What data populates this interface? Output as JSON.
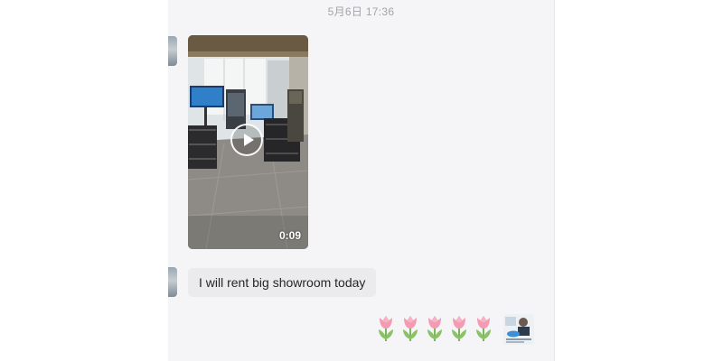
{
  "chat": {
    "timestamp": "5月6日 17:36",
    "messages": [
      {
        "sender": "contact",
        "type": "video",
        "duration": "0:09"
      },
      {
        "sender": "contact",
        "type": "text",
        "text": "I will rent big showroom today"
      },
      {
        "sender": "self",
        "type": "emoji",
        "emoji": [
          "tulip",
          "tulip",
          "tulip",
          "tulip",
          "tulip"
        ],
        "avatar": "self-avatar"
      }
    ]
  },
  "icons": {
    "play": "play-icon",
    "tulip": "tulip-emoji-icon"
  },
  "colors": {
    "panel_bg": "#f5f5f7",
    "bubble_bg": "#ebebee",
    "timestamp": "#a4a4a8",
    "tulip_petal": "#f49ab3",
    "tulip_stem": "#7cb55a"
  }
}
